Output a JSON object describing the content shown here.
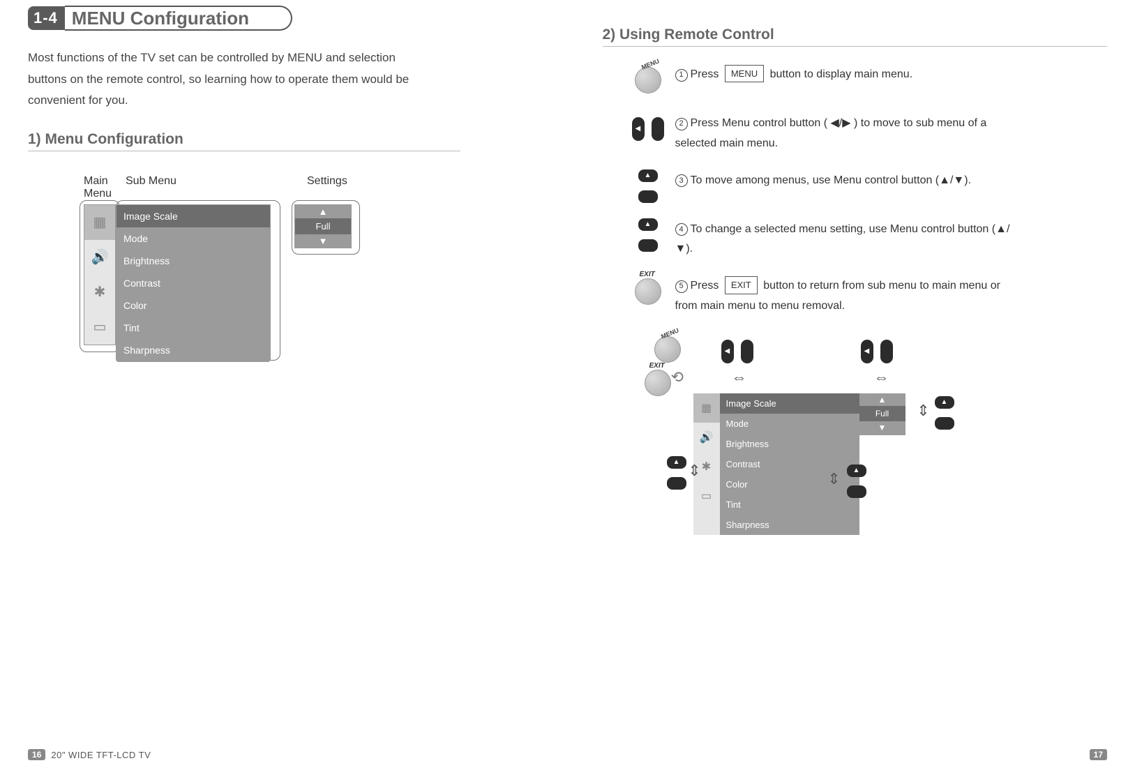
{
  "section": {
    "number": "1-4",
    "title": "MENU Configuration"
  },
  "intro": "Most functions of the TV set can be controlled by MENU and selection buttons on the remote control, so learning how to operate them would be convenient for you.",
  "sub1": {
    "heading": "1) Menu Configuration",
    "labels": {
      "main": "Main Menu",
      "sub": "Sub Menu",
      "settings": "Settings"
    }
  },
  "menu": {
    "main_icons": [
      "picture-icon",
      "sound-icon",
      "setup-icon",
      "channel-icon"
    ],
    "sub_items": [
      "Image Scale",
      "Mode",
      "Brightness",
      "Contrast",
      "Color",
      "Tint",
      "Sharpness"
    ],
    "setting_value": "Full"
  },
  "sub2": {
    "heading": "2) Using Remote Control"
  },
  "steps": [
    {
      "n": "1",
      "pre": "Press ",
      "key": "MENU",
      "post": " button to display main menu."
    },
    {
      "n": "2",
      "text": "Press Menu control button ( ◀/▶ ) to move to sub menu of a selected main menu."
    },
    {
      "n": "3",
      "text": "To move among menus, use Menu control button (▲/▼)."
    },
    {
      "n": "4",
      "text": "To change a selected menu setting, use Menu control button (▲/▼)."
    },
    {
      "n": "5",
      "pre": "Press ",
      "key": "EXIT",
      "post": " button to return from sub menu to main menu or from main menu to menu removal."
    }
  ],
  "remote_labels": {
    "menu": "MENU",
    "exit": "EXIT"
  },
  "footer": {
    "page_left": "16",
    "page_right": "17",
    "product": "20\" WIDE TFT-LCD TV"
  }
}
